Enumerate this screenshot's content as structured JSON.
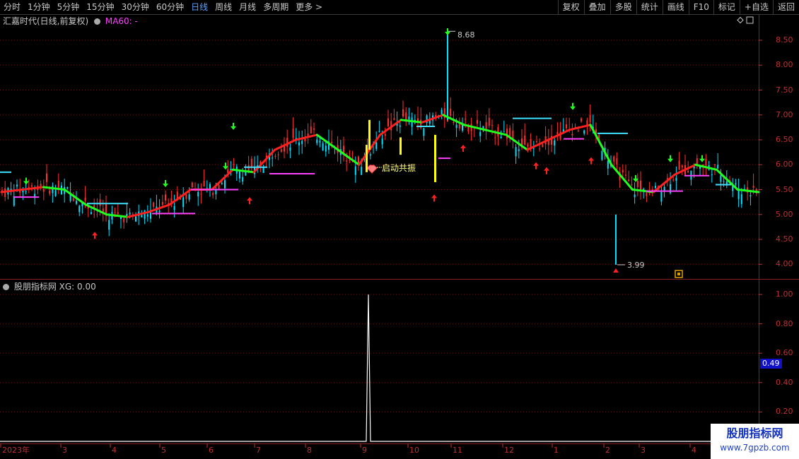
{
  "toolbar": {
    "periods": [
      {
        "label": "分时",
        "active": false
      },
      {
        "label": "1分钟",
        "active": false
      },
      {
        "label": "5分钟",
        "active": false
      },
      {
        "label": "15分钟",
        "active": false
      },
      {
        "label": "30分钟",
        "active": false
      },
      {
        "label": "60分钟",
        "active": false
      },
      {
        "label": "日线",
        "active": true
      },
      {
        "label": "周线",
        "active": false
      },
      {
        "label": "月线",
        "active": false
      },
      {
        "label": "多周期",
        "active": false
      },
      {
        "label": "更多 >",
        "active": false
      }
    ],
    "buttons": [
      "复权",
      "叠加",
      "多股",
      "统计",
      "画线",
      "F10",
      "标记",
      "+自选",
      "返回"
    ]
  },
  "main_panel": {
    "stock_title": "汇嘉时代(日线,前复权)",
    "ma_label": "MA60: -",
    "high_label": "8.68",
    "low_label": "3.99",
    "signal_label": "启动共振",
    "y_ticks": [
      "8.50",
      "8.00",
      "7.50",
      "7.00",
      "6.50",
      "6.00",
      "5.50",
      "5.00",
      "4.50",
      "4.00"
    ]
  },
  "indicator_panel": {
    "title": "股朋指标网  XG: 0.00",
    "y_ticks": [
      "1.00",
      "0.80",
      "0.60",
      "0.40",
      "0.20"
    ],
    "current_value": "0.49"
  },
  "time_axis": [
    "2023年",
    "3",
    "4",
    "5",
    "6",
    "7",
    "8",
    "9",
    "10",
    "11",
    "12",
    "1",
    "2",
    "3",
    "4"
  ],
  "watermark": {
    "line1": "股朋指标网",
    "line2": "www.7gpzb.com"
  },
  "colors": {
    "up": "#ff3030",
    "down": "#00e0ff",
    "trend_up": "#ff2020",
    "trend_down": "#20ff20",
    "signal": "#ffff00",
    "axis": "#c03030"
  },
  "chart_data": {
    "type": "line",
    "x_months": [
      "2023-02",
      "3",
      "4",
      "5",
      "6",
      "7",
      "8",
      "9",
      "10",
      "11",
      "12",
      "2024-01",
      "2",
      "3",
      "4"
    ],
    "trend_line": [
      5.45,
      5.5,
      5.55,
      5.5,
      5.2,
      5.0,
      4.95,
      5.05,
      5.2,
      5.5,
      5.5,
      5.9,
      5.85,
      6.3,
      6.5,
      6.6,
      6.3,
      6.0,
      6.6,
      6.9,
      6.85,
      7.0,
      6.8,
      6.7,
      6.6,
      6.3,
      6.5,
      6.7,
      6.8,
      6.0,
      5.5,
      5.45,
      5.8,
      6.0,
      5.9,
      5.5,
      5.45
    ],
    "high": 8.68,
    "low": 3.99,
    "indicator_xg": {
      "spike_month": "9",
      "spike_value": 1.0,
      "last": 0.0
    }
  }
}
